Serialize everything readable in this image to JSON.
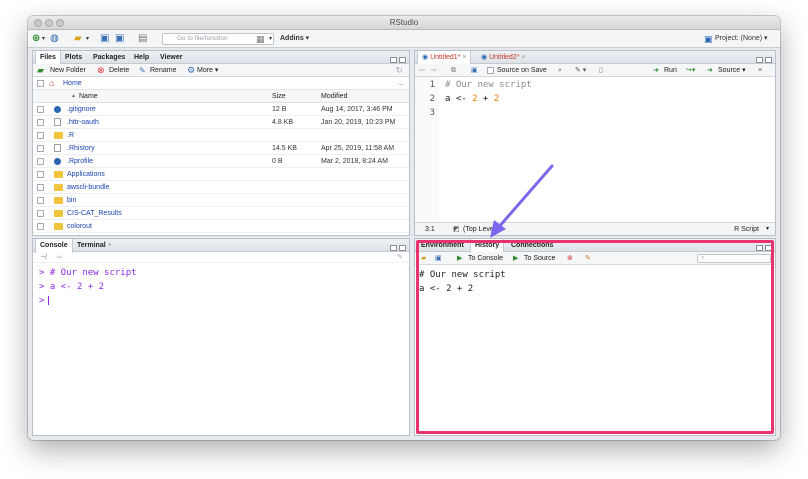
{
  "app_title": "RStudio",
  "toolbar": {
    "goto_placeholder": "Go to file/function",
    "addins_label": "Addins",
    "project_label": "Project: (None)"
  },
  "files_pane": {
    "tabs": [
      "Files",
      "Plots",
      "Packages",
      "Help",
      "Viewer"
    ],
    "actions": {
      "new_folder": "New Folder",
      "delete": "Delete",
      "rename": "Rename",
      "more": "More"
    },
    "home_label": "Home",
    "columns": {
      "name": "Name",
      "size": "Size",
      "modified": "Modified"
    },
    "rows": [
      {
        "name": ".gitignore",
        "size": "12 B",
        "modified": "Aug 14, 2017, 3:46 PM",
        "icon": "r-file"
      },
      {
        "name": ".httr-oauth",
        "size": "4.8 KB",
        "modified": "Jan 20, 2019, 10:23 PM",
        "icon": "file"
      },
      {
        "name": ".R",
        "size": "",
        "modified": "",
        "icon": "folder"
      },
      {
        "name": ".Rhistory",
        "size": "14.5 KB",
        "modified": "Apr 25, 2019, 11:58 AM",
        "icon": "file"
      },
      {
        "name": ".Rprofile",
        "size": "0 B",
        "modified": "Mar 2, 2018, 8:24 AM",
        "icon": "r-file"
      },
      {
        "name": "Applications",
        "size": "",
        "modified": "",
        "icon": "folder"
      },
      {
        "name": "awscli-bundle",
        "size": "",
        "modified": "",
        "icon": "folder"
      },
      {
        "name": "bin",
        "size": "",
        "modified": "",
        "icon": "folder"
      },
      {
        "name": "CIS-CAT_Results",
        "size": "",
        "modified": "",
        "icon": "folder"
      },
      {
        "name": "colorout",
        "size": "",
        "modified": "",
        "icon": "folder"
      }
    ]
  },
  "editor_pane": {
    "tabs": [
      "Untitled1*",
      "Untitled2*"
    ],
    "source_on_save": "Source on Save",
    "run_label": "Run",
    "source_label": "Source",
    "line_numbers": [
      "1",
      "2",
      "3"
    ],
    "lines": [
      "# Our new script",
      "a <- 2 + 2",
      ""
    ],
    "status_position": "3:1",
    "status_scope": "(Top Level)",
    "status_type": "R Script"
  },
  "console_pane": {
    "tabs": [
      "Console",
      "Terminal"
    ],
    "path": "~/",
    "lines": [
      "> # Our new script",
      "> a <- 2 + 2",
      ">"
    ]
  },
  "env_pane": {
    "tabs": [
      "Environment",
      "History",
      "Connections"
    ],
    "to_console": "To Console",
    "to_source": "To Source",
    "history_lines": [
      "# Our new script",
      "a <- 2 + 2"
    ]
  },
  "colors": {
    "highlight_border": "#e8336e",
    "arrow": "#7b68ee",
    "comment": "#8c8c8c",
    "number": "#e07b00",
    "console_text": "#8a2be2"
  }
}
